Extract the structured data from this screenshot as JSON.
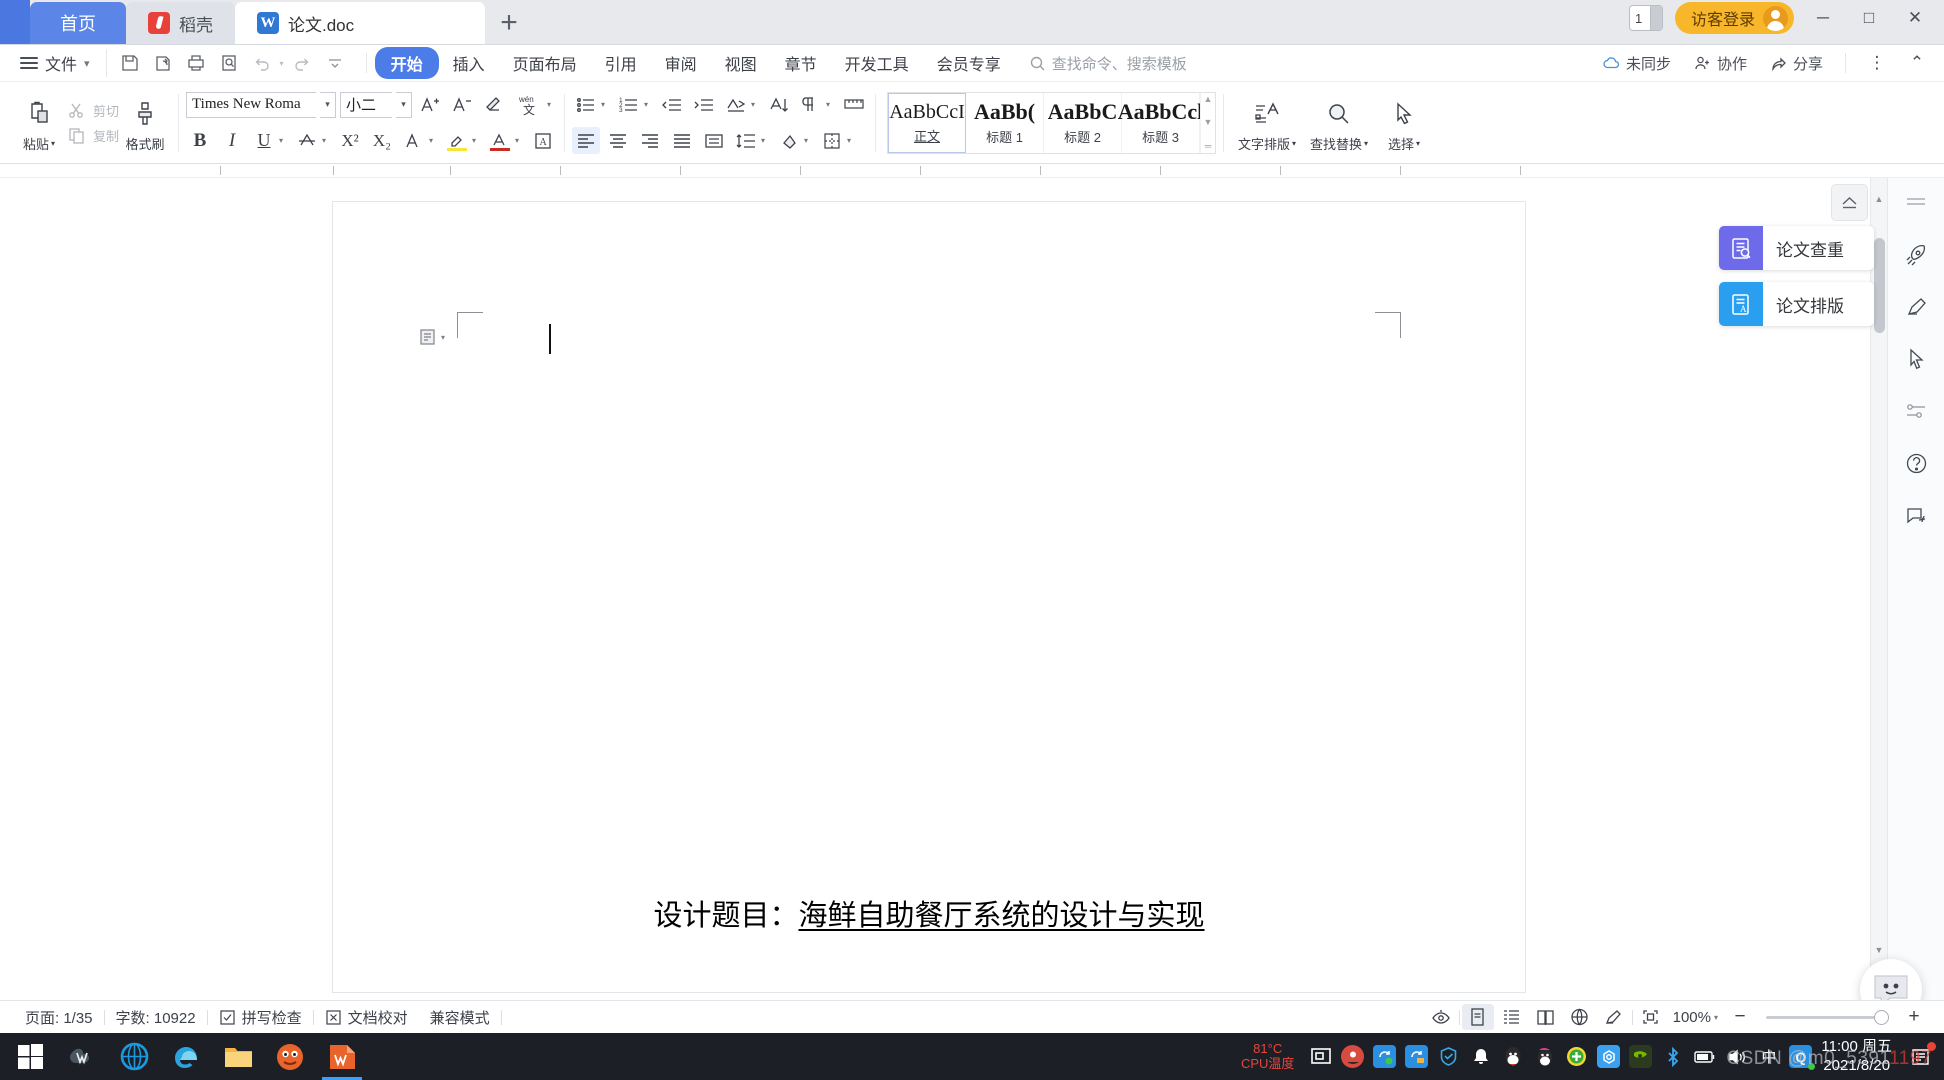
{
  "window": {
    "tabs": [
      {
        "label": "首页",
        "icon": "home-tab",
        "state": "home"
      },
      {
        "label": "稻壳",
        "icon": "docer-icon",
        "state": "inactive"
      },
      {
        "label": "论文.doc",
        "icon": "wps-writer-icon",
        "state": "active"
      }
    ],
    "new_tab": "+",
    "tab_count": "1",
    "login_label": "访客登录",
    "minimize": "─",
    "maximize": "□",
    "close": "✕"
  },
  "menubar": {
    "file_label": "文件",
    "file_caret": "⌄",
    "quick_access": [
      "save-icon",
      "save-as-icon",
      "print-icon",
      "print-preview-icon",
      "undo-icon",
      "redo-icon",
      "customize-qat-icon"
    ],
    "items": [
      {
        "label": "开始",
        "active": true
      },
      {
        "label": "插入",
        "active": false
      },
      {
        "label": "页面布局",
        "active": false
      },
      {
        "label": "引用",
        "active": false
      },
      {
        "label": "审阅",
        "active": false
      },
      {
        "label": "视图",
        "active": false
      },
      {
        "label": "章节",
        "active": false
      },
      {
        "label": "开发工具",
        "active": false
      },
      {
        "label": "会员专享",
        "active": false
      }
    ],
    "search_placeholder": "查找命令、搜索模板",
    "sync_label": "未同步",
    "collab_label": "协作",
    "share_label": "分享",
    "more_label": "⋮",
    "collapse_label": "⌃"
  },
  "ribbon": {
    "clipboard": {
      "paste_label": "粘贴",
      "cut_label": "剪切",
      "copy_label": "复制",
      "format_painter_label": "格式刷"
    },
    "font": {
      "name": "Times New Roma",
      "size": "小二",
      "grow_icon": "increase-font-size-icon",
      "shrink_icon": "decrease-font-size-icon",
      "clear_format_icon": "clear-formatting-icon",
      "pinyin_icon": "pinyin-guide-icon",
      "bold": "B",
      "italic": "I",
      "underline": "U",
      "strikethrough_icon": "strikethrough-icon",
      "superscript": "X²",
      "subscript": "X₂",
      "text_effects_icon": "text-effects-icon",
      "highlight_icon": "highlight-color-icon",
      "fontcolor_icon": "font-color-icon",
      "charborder_icon": "character-border-icon",
      "highlight_color": "#f5e63c",
      "font_color": "#cc2b22"
    },
    "paragraph": {
      "bullets_icon": "bullet-list-icon",
      "numbering_icon": "numbered-list-icon",
      "decrease_indent_icon": "decrease-indent-icon",
      "increase_indent_icon": "increase-indent-icon",
      "sort_icon": "sort-icon",
      "pinyin2_icon": "character-scaling-icon",
      "show_marks_icon": "show-formatting-marks-icon",
      "align_left_icon": "align-left-icon",
      "align_center_icon": "align-center-icon",
      "align_right_icon": "align-right-icon",
      "justify_icon": "justify-icon",
      "distribute_icon": "distribute-icon",
      "line_spacing_icon": "line-spacing-icon",
      "shading_icon": "shading-icon",
      "borders_icon": "borders-icon"
    },
    "styles": [
      {
        "preview": "AaBbCcI",
        "name": "正文",
        "bold": false,
        "selected": true
      },
      {
        "preview": "AaBb(",
        "name": "标题 1",
        "bold": true,
        "selected": false
      },
      {
        "preview": "AaBbC",
        "name": "标题 2",
        "bold": true,
        "selected": false
      },
      {
        "preview": "AaBbCcl",
        "name": "标题 3",
        "bold": true,
        "selected": false
      }
    ],
    "tools": [
      {
        "label": "文字排版",
        "icon": "text-layout-icon"
      },
      {
        "label": "查找替换",
        "icon": "find-replace-icon"
      },
      {
        "label": "选择",
        "icon": "select-icon"
      }
    ]
  },
  "document": {
    "title_prefix": "设计题目：",
    "title_underlined": "海鲜自助餐厅系统的设计与实现"
  },
  "side_panel": {
    "collapse_icon": "collapse-panel-icon",
    "buttons": [
      {
        "label": "论文查重",
        "icon": "plagiarism-check-icon",
        "color": "#6e6bea"
      },
      {
        "label": "论文排版",
        "icon": "thesis-format-icon",
        "color": "#2a9ff0"
      }
    ],
    "strip_icons": [
      "rocket-icon",
      "pen-icon",
      "cursor-icon",
      "sliders-icon",
      "help-icon",
      "feedback-icon"
    ]
  },
  "statusbar": {
    "page_label": "页面: 1/35",
    "words_label": "字数: 10922",
    "spellcheck_label": "拼写检查",
    "proofread_label": "文档校对",
    "compat_label": "兼容模式",
    "view_icons": [
      "eye-icon",
      "print-layout-icon",
      "outline-view-icon",
      "reading-layout-icon",
      "web-layout-icon",
      "ink-icon",
      "fullscreen-icon"
    ],
    "zoom_label": "100%",
    "zoom_out": "−",
    "zoom_in": "+"
  },
  "taskbar": {
    "start_icon": "windows-start-icon",
    "apps": [
      {
        "icon": "wps-cloud-icon",
        "color": "#1a7ae0",
        "glyph": "S"
      },
      {
        "icon": "internet-explorer-icon",
        "color": "#1b9ae0",
        "glyph": "e"
      },
      {
        "icon": "edge-icon",
        "color": "#2ba3dd",
        "glyph": "e"
      },
      {
        "icon": "file-explorer-icon",
        "color": "#f3b53f",
        "glyph": ""
      },
      {
        "icon": "firefox-icon",
        "color": "#e8642a",
        "glyph": ""
      },
      {
        "icon": "wps-writer-icon",
        "color": "#e8642a",
        "glyph": "W",
        "selected": true
      }
    ],
    "cpu_temp": "81°C",
    "cpu_label": "CPU温度",
    "tray_icons": [
      {
        "name": "screen-recorder-icon",
        "color": "#d94a3f"
      },
      {
        "name": "wps-sync-icon",
        "color": "#2a8fe0"
      },
      {
        "name": "wps-upload-icon",
        "color": "#2a8fe0"
      },
      {
        "name": "tencent-security-icon",
        "color": "#1f8bd6"
      },
      {
        "name": "notification-bell-icon",
        "color": "#3a4048"
      },
      {
        "name": "qq-icon",
        "color": "#2f3540"
      },
      {
        "name": "qq-pet-icon",
        "color": "#2f3540"
      },
      {
        "name": "360-safe-icon",
        "color": "#4cc24c"
      },
      {
        "name": "cloud-disk-icon",
        "color": "#3aa0f0"
      },
      {
        "name": "nvidia-icon",
        "color": "#5d8f2c"
      },
      {
        "name": "bluetooth-icon",
        "color": "#1b7fe0"
      },
      {
        "name": "battery-icon",
        "color": "#3a4048"
      },
      {
        "name": "volume-icon",
        "color": "#3a4048"
      },
      {
        "name": "ime-icon",
        "color": "#3a4048",
        "glyph": "中"
      },
      {
        "name": "qq-browser-icon",
        "color": "#2a8fe0",
        "glyph": "Q"
      }
    ],
    "clock_time": "11:00 周五",
    "clock_date": "2021/8/20",
    "action_center_icon": "action-center-icon"
  },
  "watermark": {
    "text": "CSDN @m0_5391",
    "highlight": "1197"
  }
}
